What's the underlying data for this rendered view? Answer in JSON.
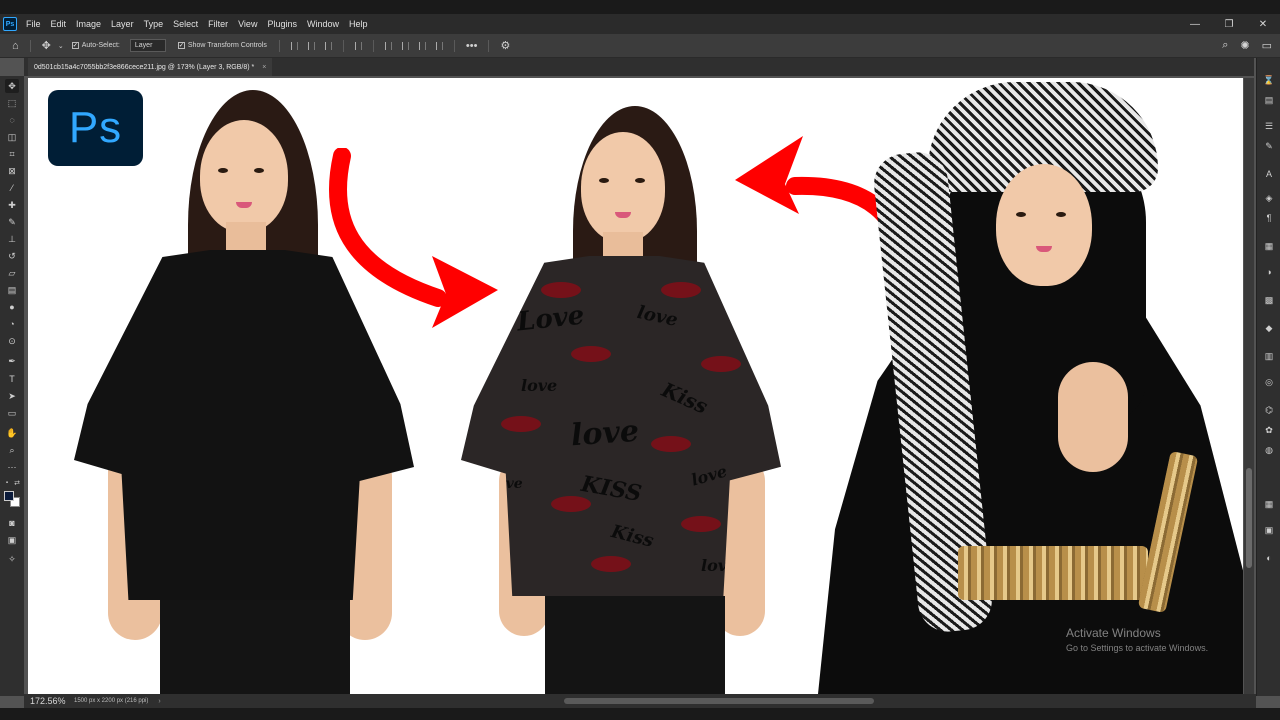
{
  "menubar": {
    "items": [
      "File",
      "Edit",
      "Image",
      "Layer",
      "Type",
      "Select",
      "Filter",
      "View",
      "Plugins",
      "Window",
      "Help"
    ],
    "window_controls": [
      "—",
      "❐",
      "✕"
    ]
  },
  "options": {
    "auto_select_label": "Auto-Select:",
    "layer_select": "Layer",
    "transform_label": "Show Transform Controls",
    "more": "•••"
  },
  "document": {
    "tab_title": "0d501cb15a4c7055bb2f3e866cece211.jpg @ 173% (Layer 3, RGB/8) *",
    "close": "×"
  },
  "canvas": {
    "logo_text": "Ps",
    "print_words": [
      "Love",
      "love",
      "Kiss",
      "love",
      "KISS",
      "love",
      "love",
      "Kiss",
      "love",
      "love"
    ]
  },
  "watermark": {
    "title": "Activate Windows",
    "subtitle": "Go to Settings to activate Windows."
  },
  "status": {
    "zoom": "172.56%",
    "info": "1500 px x 2200 px (216 ppi)",
    "arrow": "›"
  },
  "colors": {
    "accent": "#31a8ff",
    "ps_bg": "#001e36",
    "arrow_red": "#ff0000",
    "foreground": "#0a1a3a",
    "background": "#ffffff"
  },
  "toolbar_icons": [
    "move-icon",
    "marquee-icon",
    "lasso-icon",
    "object-select-icon",
    "crop-icon",
    "frame-icon",
    "eyedropper-icon",
    "healing-brush-icon",
    "brush-icon",
    "clone-stamp-icon",
    "history-brush-icon",
    "eraser-icon",
    "gradient-icon",
    "blur-icon",
    "dodge-icon",
    "pen-icon",
    "type-icon",
    "path-select-icon",
    "rectangle-icon",
    "hand-icon",
    "zoom-icon",
    "more-tools-icon"
  ],
  "panel_icons": [
    "history-icon",
    "comments-icon",
    "adjustments-icon",
    "brush-settings-icon",
    "character-icon",
    "glyphs-icon",
    "paragraph-icon",
    "libraries-icon",
    "color-icon",
    "swatches-icon",
    "layers-icon",
    "gradients-icon",
    "channels-icon",
    "paths-icon",
    "properties-icon",
    "styles-icon",
    "patterns-icon",
    "navigator-icon",
    "info-icon"
  ]
}
